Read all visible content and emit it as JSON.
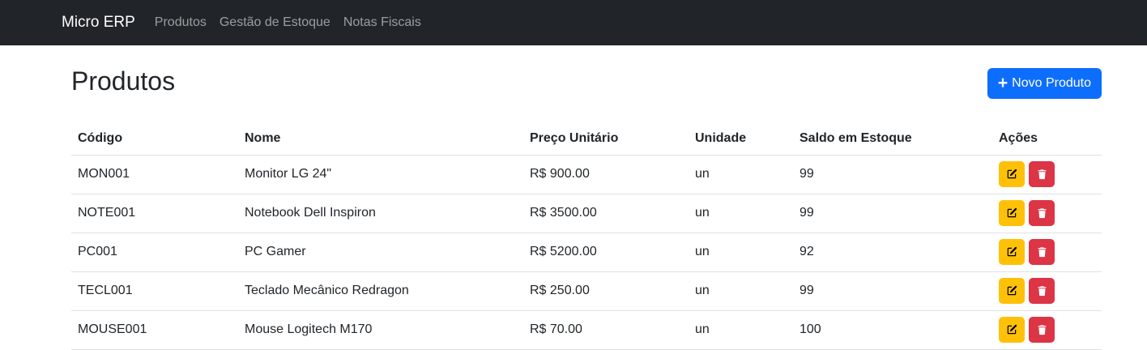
{
  "navbar": {
    "brand": "Micro ERP",
    "links": [
      "Produtos",
      "Gestão de Estoque",
      "Notas Fiscais"
    ]
  },
  "page": {
    "title": "Produtos",
    "new_button_label": "Novo Produto",
    "new_button_icon": "plus-icon"
  },
  "table": {
    "headers": [
      "Código",
      "Nome",
      "Preço Unitário",
      "Unidade",
      "Saldo em Estoque",
      "Ações"
    ],
    "rows": [
      {
        "codigo": "MON001",
        "nome": "Monitor LG 24\"",
        "preco": "R$ 900.00",
        "unidade": "un",
        "saldo": "99"
      },
      {
        "codigo": "NOTE001",
        "nome": "Notebook Dell Inspiron",
        "preco": "R$ 3500.00",
        "unidade": "un",
        "saldo": "99"
      },
      {
        "codigo": "PC001",
        "nome": "PC Gamer",
        "preco": "R$ 5200.00",
        "unidade": "un",
        "saldo": "92"
      },
      {
        "codigo": "TECL001",
        "nome": "Teclado Mecânico Redragon",
        "preco": "R$ 250.00",
        "unidade": "un",
        "saldo": "99"
      },
      {
        "codigo": "MOUSE001",
        "nome": "Mouse Logitech M170",
        "preco": "R$ 70.00",
        "unidade": "un",
        "saldo": "100"
      }
    ],
    "action_icons": {
      "edit": "edit-icon",
      "delete": "trash-icon"
    }
  },
  "colors": {
    "navbar_bg": "#212529",
    "primary": "#0d6efd",
    "warning": "#ffc107",
    "danger": "#dc3545"
  }
}
